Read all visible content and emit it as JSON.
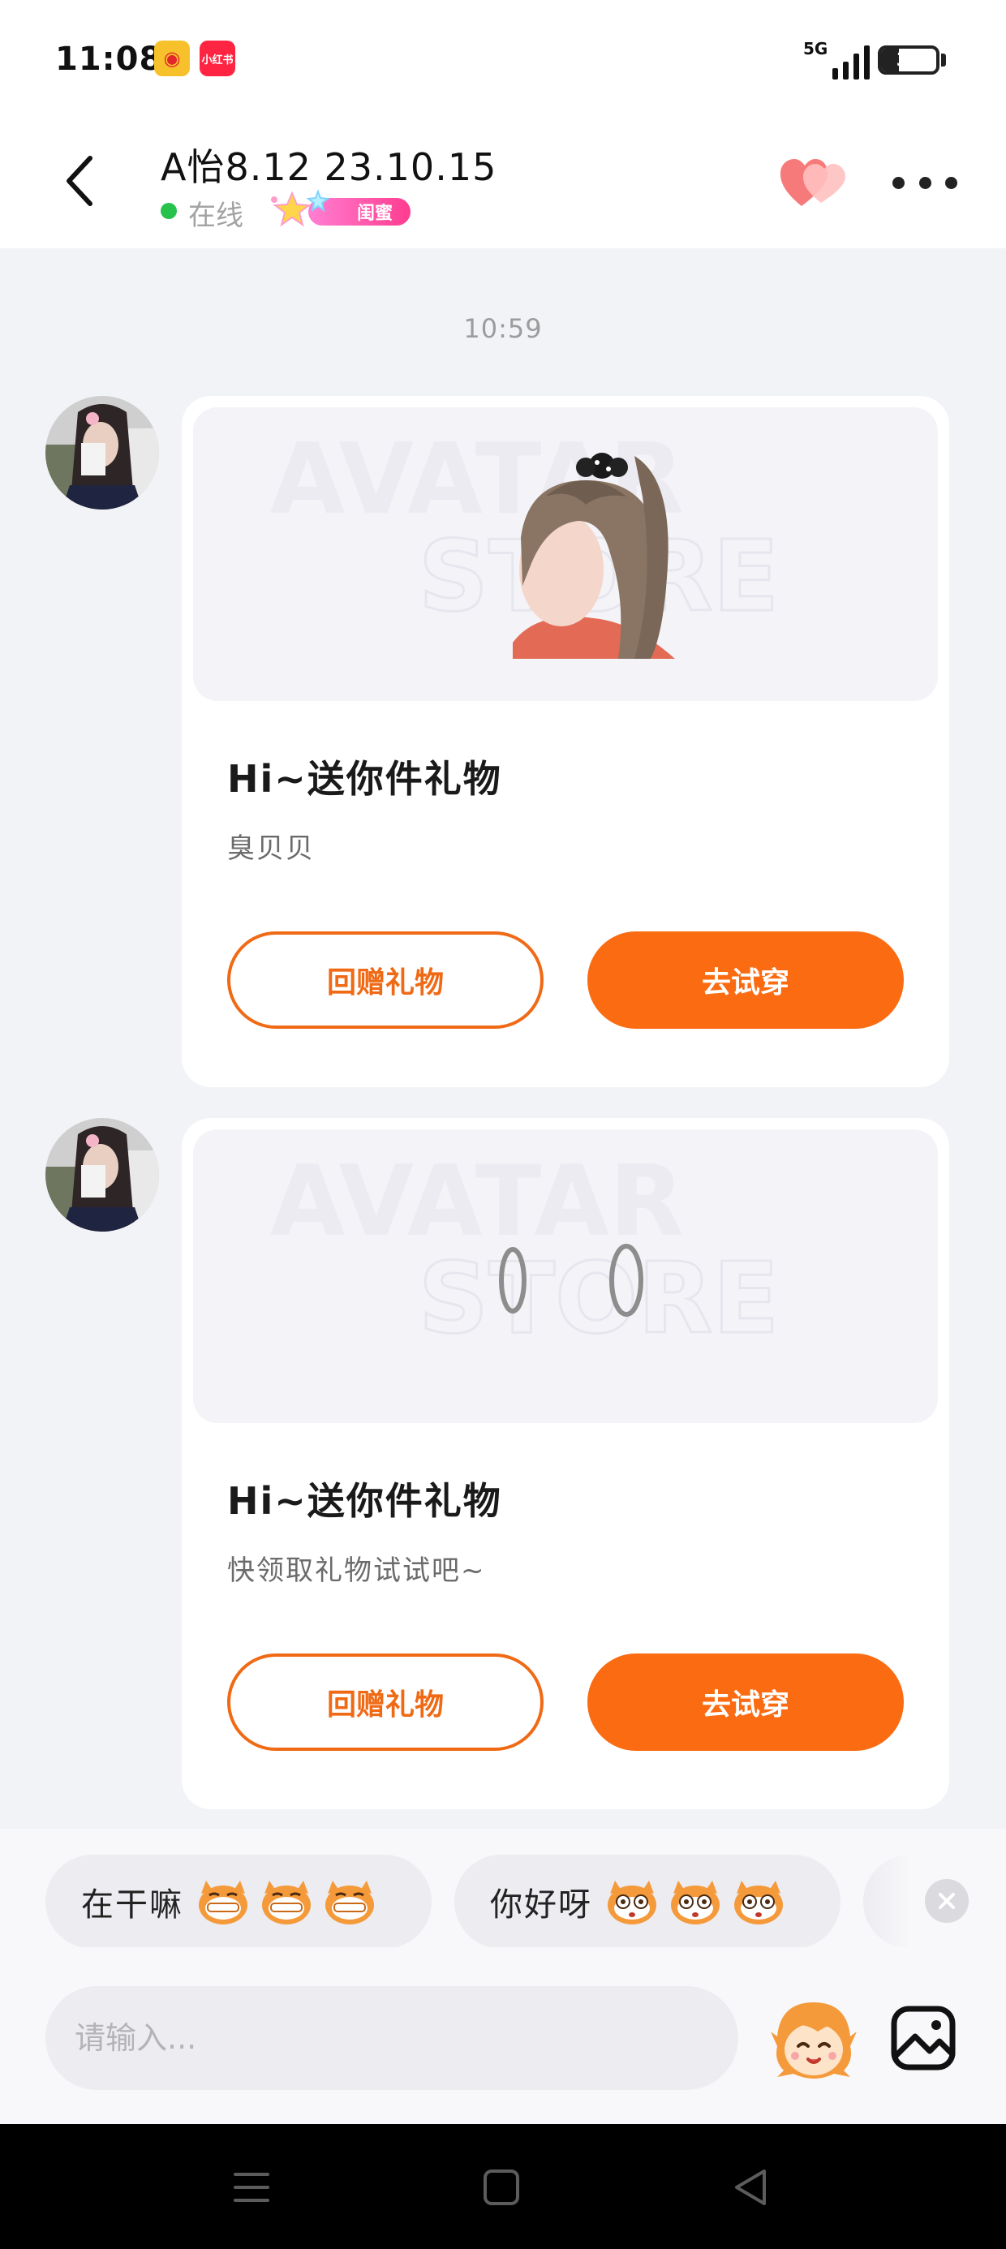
{
  "status_bar": {
    "time": "11:08",
    "weibo_glyph": "◉",
    "xhs_label": "小红书",
    "network": "5G",
    "signal_bars": 4,
    "battery_percent": "32",
    "battery_level": 0.32
  },
  "header": {
    "back_icon": "chevron-left-icon",
    "title": "A怡8.12 23.10.15",
    "status": "在线",
    "badge_label": "闺蜜",
    "heart_icon": "double-heart-icon",
    "more_icon": "more-dots-icon"
  },
  "chat": {
    "timestamp": "10:59",
    "messages": [
      {
        "title": "Hi~送你件礼物",
        "subtitle": "臭贝贝",
        "return_gift_label": "回赠礼物",
        "try_on_label": "去试穿",
        "media_watermark_1": "AVATAR",
        "media_watermark_2": "STORE",
        "media_item": "hairstyle-preview"
      },
      {
        "title": "Hi~送你件礼物",
        "subtitle": "快领取礼物试试吧~",
        "return_gift_label": "回赠礼物",
        "try_on_label": "去试穿",
        "media_watermark_1": "AVATAR",
        "media_watermark_2": "STORE",
        "media_item": "earrings-preview"
      }
    ]
  },
  "quick_replies": [
    {
      "text": "在干嘛"
    },
    {
      "text": "你好呀"
    }
  ],
  "input": {
    "placeholder": "请输入..."
  },
  "colors": {
    "accent": "#fb6b11",
    "accent_border": "#f06a15",
    "online": "#27c24c",
    "badge_pink": "#ff3c8f",
    "heart": "#f77a7a",
    "background": "#f2f3f7"
  }
}
